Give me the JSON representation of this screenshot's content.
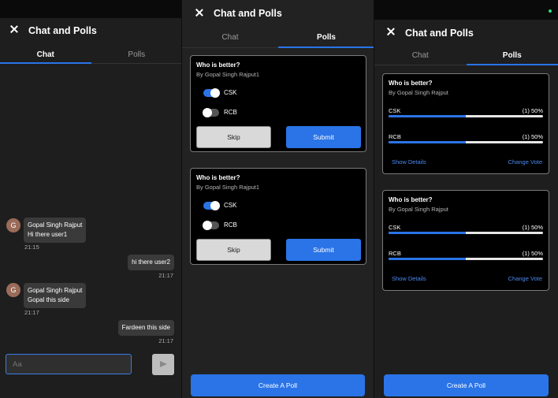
{
  "chat_panel": {
    "title": "Chat and Polls",
    "tabs": [
      "Chat",
      "Polls"
    ],
    "messages": [
      {
        "sender": "Gopal Singh Rajput",
        "avatar": "G",
        "text": "Hi there user1",
        "time": "21:15",
        "own": false
      },
      {
        "text": "hi there user2",
        "time": "21:17",
        "own": true
      },
      {
        "sender": "Gopal Singh Rajput",
        "avatar": "G",
        "text": "Gopal this side",
        "time": "21:17",
        "own": false
      },
      {
        "text": "Fardeen this side",
        "time": "21:17",
        "own": true
      }
    ],
    "input_placeholder": "Aa",
    "send_icon": "send-icon"
  },
  "polls_vote_panel": {
    "title": "Chat and Polls",
    "tabs": [
      "Chat",
      "Polls"
    ],
    "polls": [
      {
        "question": "Who is better?",
        "by": "By Gopal Singh Rajput1",
        "options": [
          {
            "label": "CSK",
            "on": true
          },
          {
            "label": "RCB",
            "on": false
          }
        ],
        "skip": "Skip",
        "submit": "Submit"
      },
      {
        "question": "Who is better?",
        "by": "By Gopal Singh Rajput1",
        "options": [
          {
            "label": "CSK",
            "on": true
          },
          {
            "label": "RCB",
            "on": false
          }
        ],
        "skip": "Skip",
        "submit": "Submit"
      }
    ],
    "create_poll": "Create A Poll"
  },
  "polls_result_panel": {
    "title": "Chat and Polls",
    "tabs": [
      "Chat",
      "Polls"
    ],
    "polls": [
      {
        "question": "Who is better?",
        "by": "By Gopal Singh Rajput",
        "results": [
          {
            "label": "CSK",
            "count": "(1) 50%",
            "fraction": 0.5
          },
          {
            "label": "RCB",
            "count": "(1) 50%",
            "fraction": 0.5
          }
        ],
        "show_details": "Show Details",
        "change_vote": "Change Vote"
      },
      {
        "question": "Who is better?",
        "by": "By Gopal Singh Rajput",
        "results": [
          {
            "label": "CSK",
            "count": "(1) 50%",
            "fraction": 0.5
          },
          {
            "label": "RCB",
            "count": "(1) 50%",
            "fraction": 0.5
          }
        ],
        "show_details": "Show Details",
        "change_vote": "Change Vote"
      }
    ],
    "create_poll": "Create A Poll"
  },
  "colors": {
    "accent": "#2a74e8",
    "background": "#1e1e1e",
    "card": "#000000",
    "bubble": "#3a3a3a"
  }
}
